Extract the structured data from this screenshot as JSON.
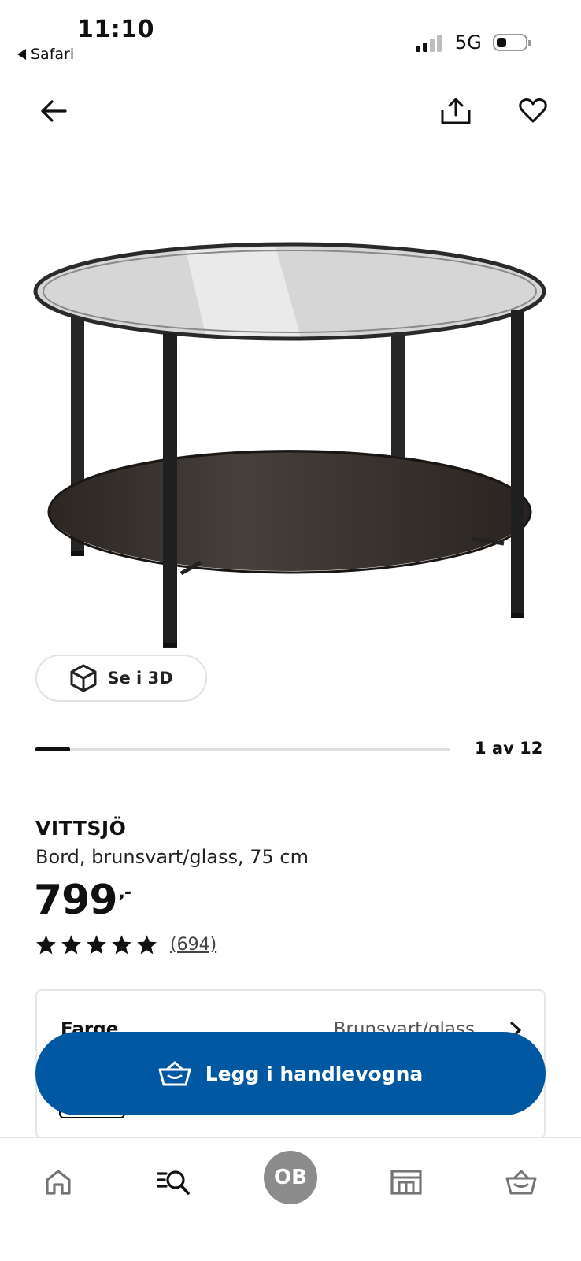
{
  "status_bar": {
    "time": "11:10",
    "back_app": "Safari",
    "network": "5G"
  },
  "top_nav": {
    "icons": [
      "back-arrow-icon",
      "share-icon",
      "heart-icon"
    ]
  },
  "gallery": {
    "view_3d_label": "Se i 3D",
    "counter": "1 av 12",
    "progress": 0.083
  },
  "product": {
    "name": "VITTSJÖ",
    "description": "Bord, brunsvart/glass, 75 cm",
    "price": "799",
    "price_suffix": ",-",
    "rating_stars": 5,
    "review_count": "(694)"
  },
  "option": {
    "label": "Farge",
    "value": "Brunsvart/glass"
  },
  "cart_button": {
    "label": "Legg i handlevogna"
  },
  "tab_bar": {
    "avatar_initials": "OB",
    "icons": [
      "home-icon",
      "search-list-icon",
      "avatar",
      "store-icon",
      "basket-icon"
    ]
  },
  "colors": {
    "primary_blue": "#0058a3",
    "avatar_grey": "#8c8c8c"
  }
}
